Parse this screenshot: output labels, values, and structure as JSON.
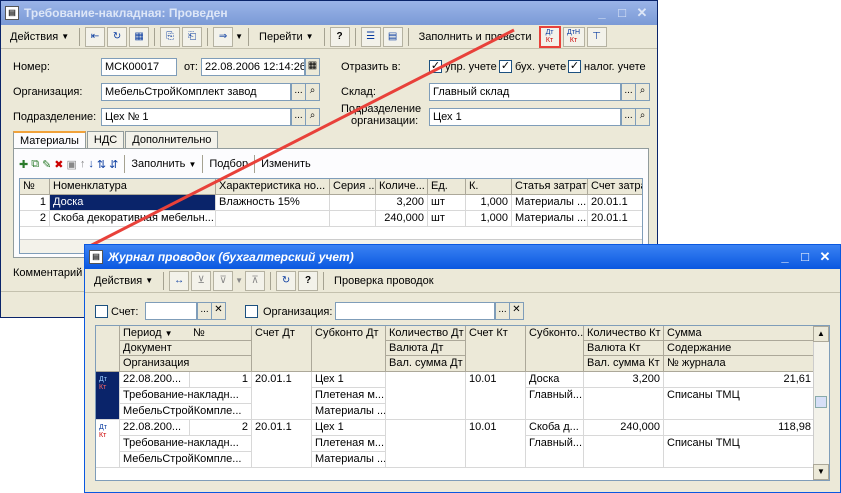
{
  "main": {
    "title": "Требование-накладная: Проведен",
    "toolbar": {
      "actions": "Действия",
      "goto": "Перейти",
      "help": "?",
      "fill_post": "Заполнить и провести",
      "dt_kt": "Дт Кт",
      "dt_kt2": "ДтН Кт"
    },
    "number_label": "Номер:",
    "number_value": "МСК00017",
    "from_label": "от:",
    "date_value": "22.08.2006 12:14:26",
    "reflect_label": "Отразить в:",
    "upr_label": "упр. учете",
    "buh_label": "бух. учете",
    "nalog_label": "налог. учете",
    "org_label": "Организация:",
    "org_value": "МебельСтройКомплект завод",
    "sklad_label": "Склад:",
    "sklad_value": "Главный склад",
    "podr_label": "Подразделение:",
    "podr_value": "Цех № 1",
    "podr_org_label1": "Подразделение",
    "podr_org_label2": "организации:",
    "podr_org_value": "Цех 1",
    "tabs": [
      "Материалы",
      "НДС",
      "Дополнительно"
    ],
    "grid_toolbar": {
      "fill": "Заполнить",
      "select": "Подбор",
      "change": "Изменить"
    },
    "grid_headers": [
      "№",
      "Номенклатура",
      "Характеристика но...",
      "Серия ...",
      "Количе...",
      "Ед.",
      "К.",
      "Статья затрат",
      "Счет затра"
    ],
    "rows": [
      [
        "1",
        "Доска",
        "Влажность 15%",
        "",
        "3,200",
        "шт",
        "1,000",
        "Материалы ...",
        "20.01.1"
      ],
      [
        "2",
        "Скоба декоративная мебельн...",
        "",
        "",
        "240,000",
        "шт",
        "1,000",
        "Материалы ...",
        "20.01.1"
      ]
    ],
    "comment_label": "Комментарий"
  },
  "journal": {
    "title": "Журнал проводок (бухгалтерский учет)",
    "toolbar": {
      "actions": "Действия",
      "help": "?",
      "check": "Проверка проводок"
    },
    "schet_label": "Счет:",
    "org_label": "Организация:",
    "headers": {
      "period": "Период",
      "num": "№",
      "doc": "Документ",
      "org": "Организация",
      "schet_dt": "Счет Дт",
      "subk_dt": "Субконто Дт",
      "kol_dt": "Количество Дт",
      "val_dt": "Валюта Дт",
      "valsum_dt": "Вал. сумма Дт",
      "schet_kt": "Счет Кт",
      "subk_kt": "Субконто...",
      "kol_kt": "Количество Кт",
      "val_kt": "Валюта Кт",
      "valsum_kt": "Вал. сумма Кт",
      "summa": "Сумма",
      "soderzh": "Содержание",
      "nzh": "№ журнала"
    },
    "entries": [
      {
        "period": "22.08.200...",
        "num": "1",
        "doc": "Требование-накладн...",
        "org": "МебельСтройКомпле...",
        "schet_dt": "20.01.1",
        "subk1": "Цех 1",
        "subk2": "Плетеная м...",
        "subk3": "Материалы ...",
        "schet_kt": "10.01",
        "subk_kt1": "Доска",
        "subk_kt2": "Главный...",
        "kol_kt": "3,200",
        "summa": "21,61",
        "soderzh": "Списаны ТМЦ"
      },
      {
        "period": "22.08.200...",
        "num": "2",
        "doc": "Требование-накладн...",
        "org": "МебельСтройКомпле...",
        "schet_dt": "20.01.1",
        "subk1": "Цех 1",
        "subk2": "Плетеная м...",
        "subk3": "Материалы ...",
        "schet_kt": "10.01",
        "subk_kt1": "Скоба д...",
        "subk_kt2": "Главный...",
        "kol_kt": "240,000",
        "summa": "118,98",
        "soderzh": "Списаны ТМЦ"
      }
    ],
    "dtkt_icon": "Дт Кт"
  },
  "colors": {
    "accent_line": "#e8413a",
    "active_title": "#0a58e0"
  }
}
